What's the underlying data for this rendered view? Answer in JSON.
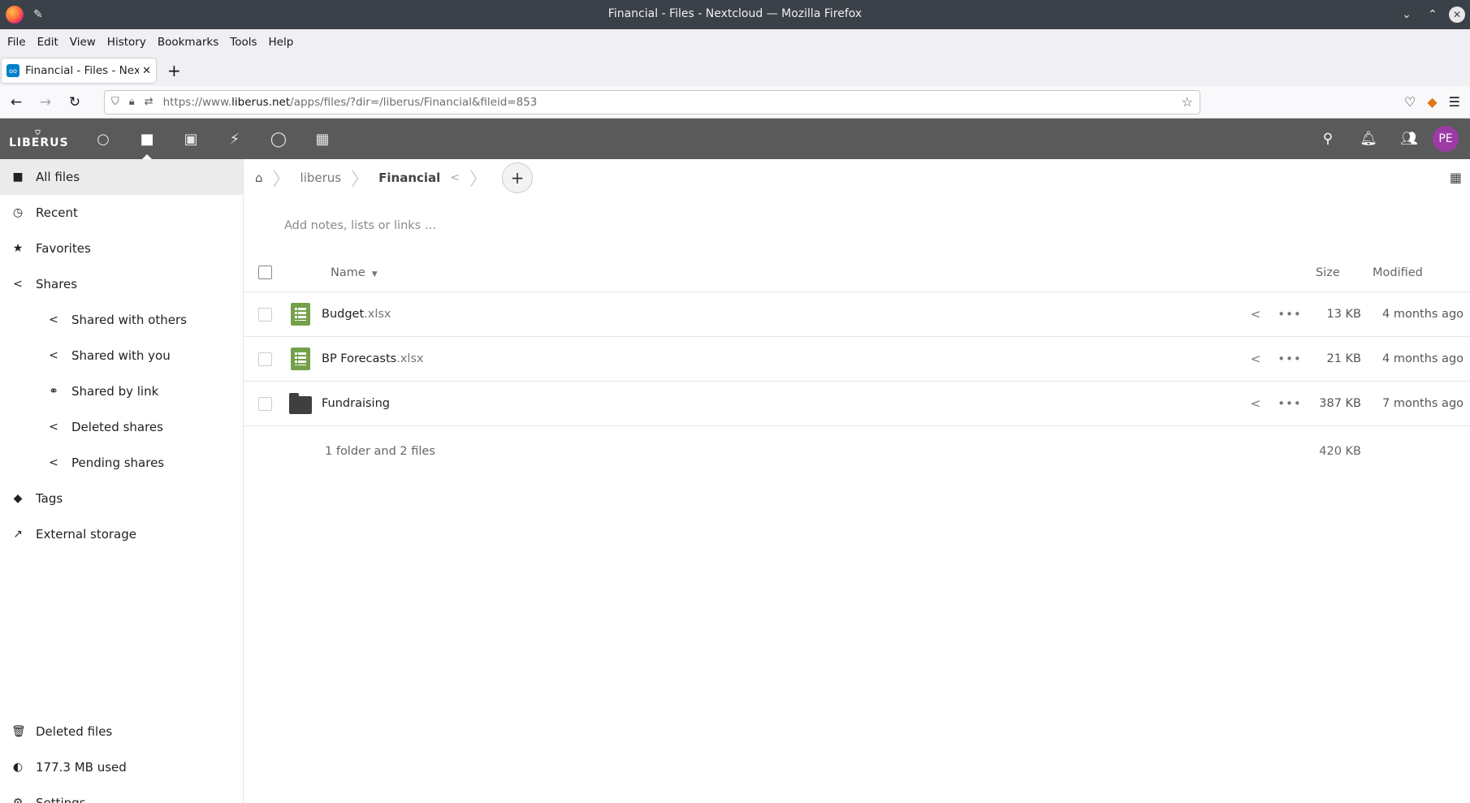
{
  "window": {
    "title": "Financial - Files - Nextcloud — Mozilla Firefox"
  },
  "menubar": [
    "File",
    "Edit",
    "View",
    "History",
    "Bookmarks",
    "Tools",
    "Help"
  ],
  "tab": {
    "label": "Financial - Files - Nextcloud"
  },
  "urlbar": {
    "prefix": "https://www.",
    "domain": "liberus.net",
    "path": "/apps/files/?dir=/liberus/Financial&fileid=853"
  },
  "nc": {
    "logo": "LIBERUS",
    "avatar_initials": "PE",
    "apps": [
      {
        "name": "dashboard",
        "icon": "○"
      },
      {
        "name": "files",
        "icon": "■"
      },
      {
        "name": "photos",
        "icon": "▣"
      },
      {
        "name": "activity",
        "icon": "⚡"
      },
      {
        "name": "talk",
        "icon": "◯"
      },
      {
        "name": "calendar",
        "icon": "▦"
      }
    ]
  },
  "sidebar": {
    "items": [
      {
        "label": "All files",
        "icon": "folder-icon"
      },
      {
        "label": "Recent",
        "icon": "clock-icon"
      },
      {
        "label": "Favorites",
        "icon": "star-icon"
      },
      {
        "label": "Shares",
        "icon": "share-icon"
      },
      {
        "label": "Shared with others",
        "icon": "share-icon"
      },
      {
        "label": "Shared with you",
        "icon": "share-icon"
      },
      {
        "label": "Shared by link",
        "icon": "link-icon"
      },
      {
        "label": "Deleted shares",
        "icon": "share-icon"
      },
      {
        "label": "Pending shares",
        "icon": "share-icon"
      },
      {
        "label": "Tags",
        "icon": "tag-icon"
      },
      {
        "label": "External storage",
        "icon": "external-link-icon"
      }
    ],
    "bottom": [
      {
        "label": "Deleted files",
        "icon": "trash-icon"
      },
      {
        "label": "177.3 MB used",
        "icon": "pie-icon"
      },
      {
        "label": "Settings",
        "icon": "gear-icon"
      }
    ]
  },
  "breadcrumb": {
    "items": [
      "liberus",
      "Financial"
    ]
  },
  "notes": {
    "placeholder": "Add notes, lists or links …"
  },
  "table": {
    "headers": {
      "name": "Name",
      "size": "Size",
      "modified": "Modified"
    },
    "rows": [
      {
        "base": "Budget",
        "ext": ".xlsx",
        "type": "spreadsheet",
        "size": "13 KB",
        "modified": "4 months ago"
      },
      {
        "base": "BP Forecasts",
        "ext": ".xlsx",
        "type": "spreadsheet",
        "size": "21 KB",
        "modified": "4 months ago"
      },
      {
        "base": "Fundraising",
        "ext": "",
        "type": "folder",
        "size": "387 KB",
        "modified": "7 months ago"
      }
    ],
    "summary": {
      "text": "1 folder and 2 files",
      "size": "420 KB"
    }
  }
}
